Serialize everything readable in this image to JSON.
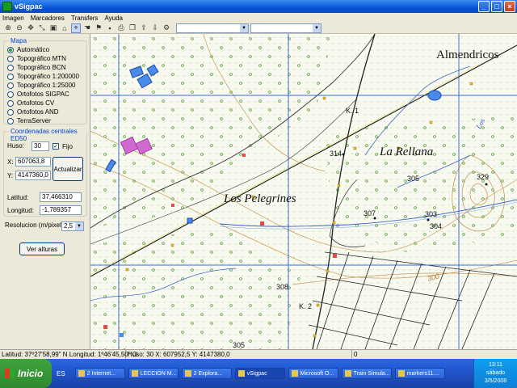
{
  "window": {
    "title": "vSigpac"
  },
  "menu": [
    "Imagen",
    "Marcadores",
    "Transfers",
    "Ayuda"
  ],
  "mapa": {
    "legend": "Mapa",
    "options": [
      {
        "label": "Automático",
        "selected": true
      },
      {
        "label": "Topográfico MTN",
        "selected": false
      },
      {
        "label": "Topográfico BCN",
        "selected": false
      },
      {
        "label": "Topográfico 1:200000",
        "selected": false
      },
      {
        "label": "Topográfico 1:25000",
        "selected": false
      },
      {
        "label": "Ortofotos SIGPAC",
        "selected": false
      },
      {
        "label": "Ortofotos CV",
        "selected": false
      },
      {
        "label": "Ortofotos AND",
        "selected": false
      },
      {
        "label": "TerraServer",
        "selected": false
      }
    ]
  },
  "coords": {
    "legend": "Coordenadas centrales ED50",
    "huso_label": "Huso:",
    "huso_value": "30",
    "fijo_label": "Fijo",
    "x_label": "X:",
    "x_value": "607063,8",
    "y_label": "Y:",
    "y_value": "4147360,0",
    "actualizar_label": "Actualizar",
    "latitud_label": "Latitud:",
    "latitud_value": "37,466310",
    "longitud_label": "Longitud:",
    "longitud_value": "-1,789357"
  },
  "resolucion": {
    "label": "Resolucion (m/pixel)",
    "value": "2,5"
  },
  "ver_alturas_label": "Ver alturas",
  "map_labels": {
    "almendricos": "Almendricos",
    "la_rellana": "La Rellana",
    "los_pelegrines": "Los Pelegrines",
    "k1": "K. 1",
    "k2": "K. 2",
    "los": "Los",
    "e314": "314",
    "e305a": "305",
    "e329": "329",
    "e307": "307",
    "e303": "303",
    "e304": "304",
    "e308": "308",
    "e300": "300",
    "e305b": "305"
  },
  "status": {
    "latlon": "Latitud: 37º27'58,99\" N Longitud: 1º46'45,50\" O",
    "huso": "Huso: 30 X: 607952,5 Y: 4147380,0",
    "value": "0"
  },
  "taskbar": {
    "start_label": "Inicio",
    "lang": "ES",
    "tasks": [
      "2 Internet...",
      "LECCIÓN M...",
      "2 Explora...",
      "vSigpac",
      "Microsoft O...",
      "Train Simula...",
      "markers11...."
    ],
    "clock": "13:11",
    "day": "sábado",
    "date": "3/5/2008"
  }
}
